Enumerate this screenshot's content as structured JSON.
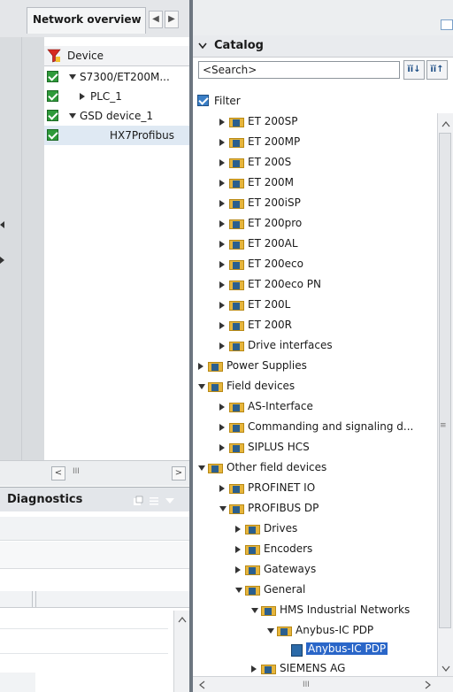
{
  "network_overview": {
    "tab_label": "Network overview",
    "column_header": "Device",
    "rows": [
      {
        "label": "S7300/ET200M..."
      },
      {
        "label": "PLC_1"
      },
      {
        "label": "GSD device_1"
      },
      {
        "label": "HX7Profibus"
      }
    ],
    "scroll_left": "<",
    "scroll_right": ">",
    "scroll_thumb": "III"
  },
  "diagnostics": {
    "title": "Diagnostics"
  },
  "catalog": {
    "title": "Catalog",
    "search_value": "<Search>",
    "filter_label": "Filter",
    "tree": [
      {
        "label": "ET 200SP"
      },
      {
        "label": "ET 200MP"
      },
      {
        "label": "ET 200S"
      },
      {
        "label": "ET 200M"
      },
      {
        "label": "ET 200iSP"
      },
      {
        "label": "ET 200pro"
      },
      {
        "label": "ET 200AL"
      },
      {
        "label": "ET 200eco"
      },
      {
        "label": "ET 200eco PN"
      },
      {
        "label": "ET 200L"
      },
      {
        "label": "ET 200R"
      },
      {
        "label": "Drive interfaces"
      },
      {
        "label": "Power Supplies"
      },
      {
        "label": "Field devices"
      },
      {
        "label": "AS-Interface"
      },
      {
        "label": "Commanding and signaling d..."
      },
      {
        "label": "SIPLUS HCS"
      },
      {
        "label": "Other field devices"
      },
      {
        "label": "PROFINET IO"
      },
      {
        "label": "PROFIBUS DP"
      },
      {
        "label": "Drives"
      },
      {
        "label": "Encoders"
      },
      {
        "label": "Gateways"
      },
      {
        "label": "General"
      },
      {
        "label": "HMS Industrial Networks"
      },
      {
        "label": "Anybus-IC PDP"
      },
      {
        "label": "Anybus-IC PDP"
      },
      {
        "label": "SIEMENS AG"
      }
    ],
    "scroll_thumb": "III"
  },
  "colors": {
    "selected_highlight": "#2a66c8",
    "check_green": "#2e9a3a",
    "folder": "#e6b53c",
    "divider": "#6d7680"
  }
}
